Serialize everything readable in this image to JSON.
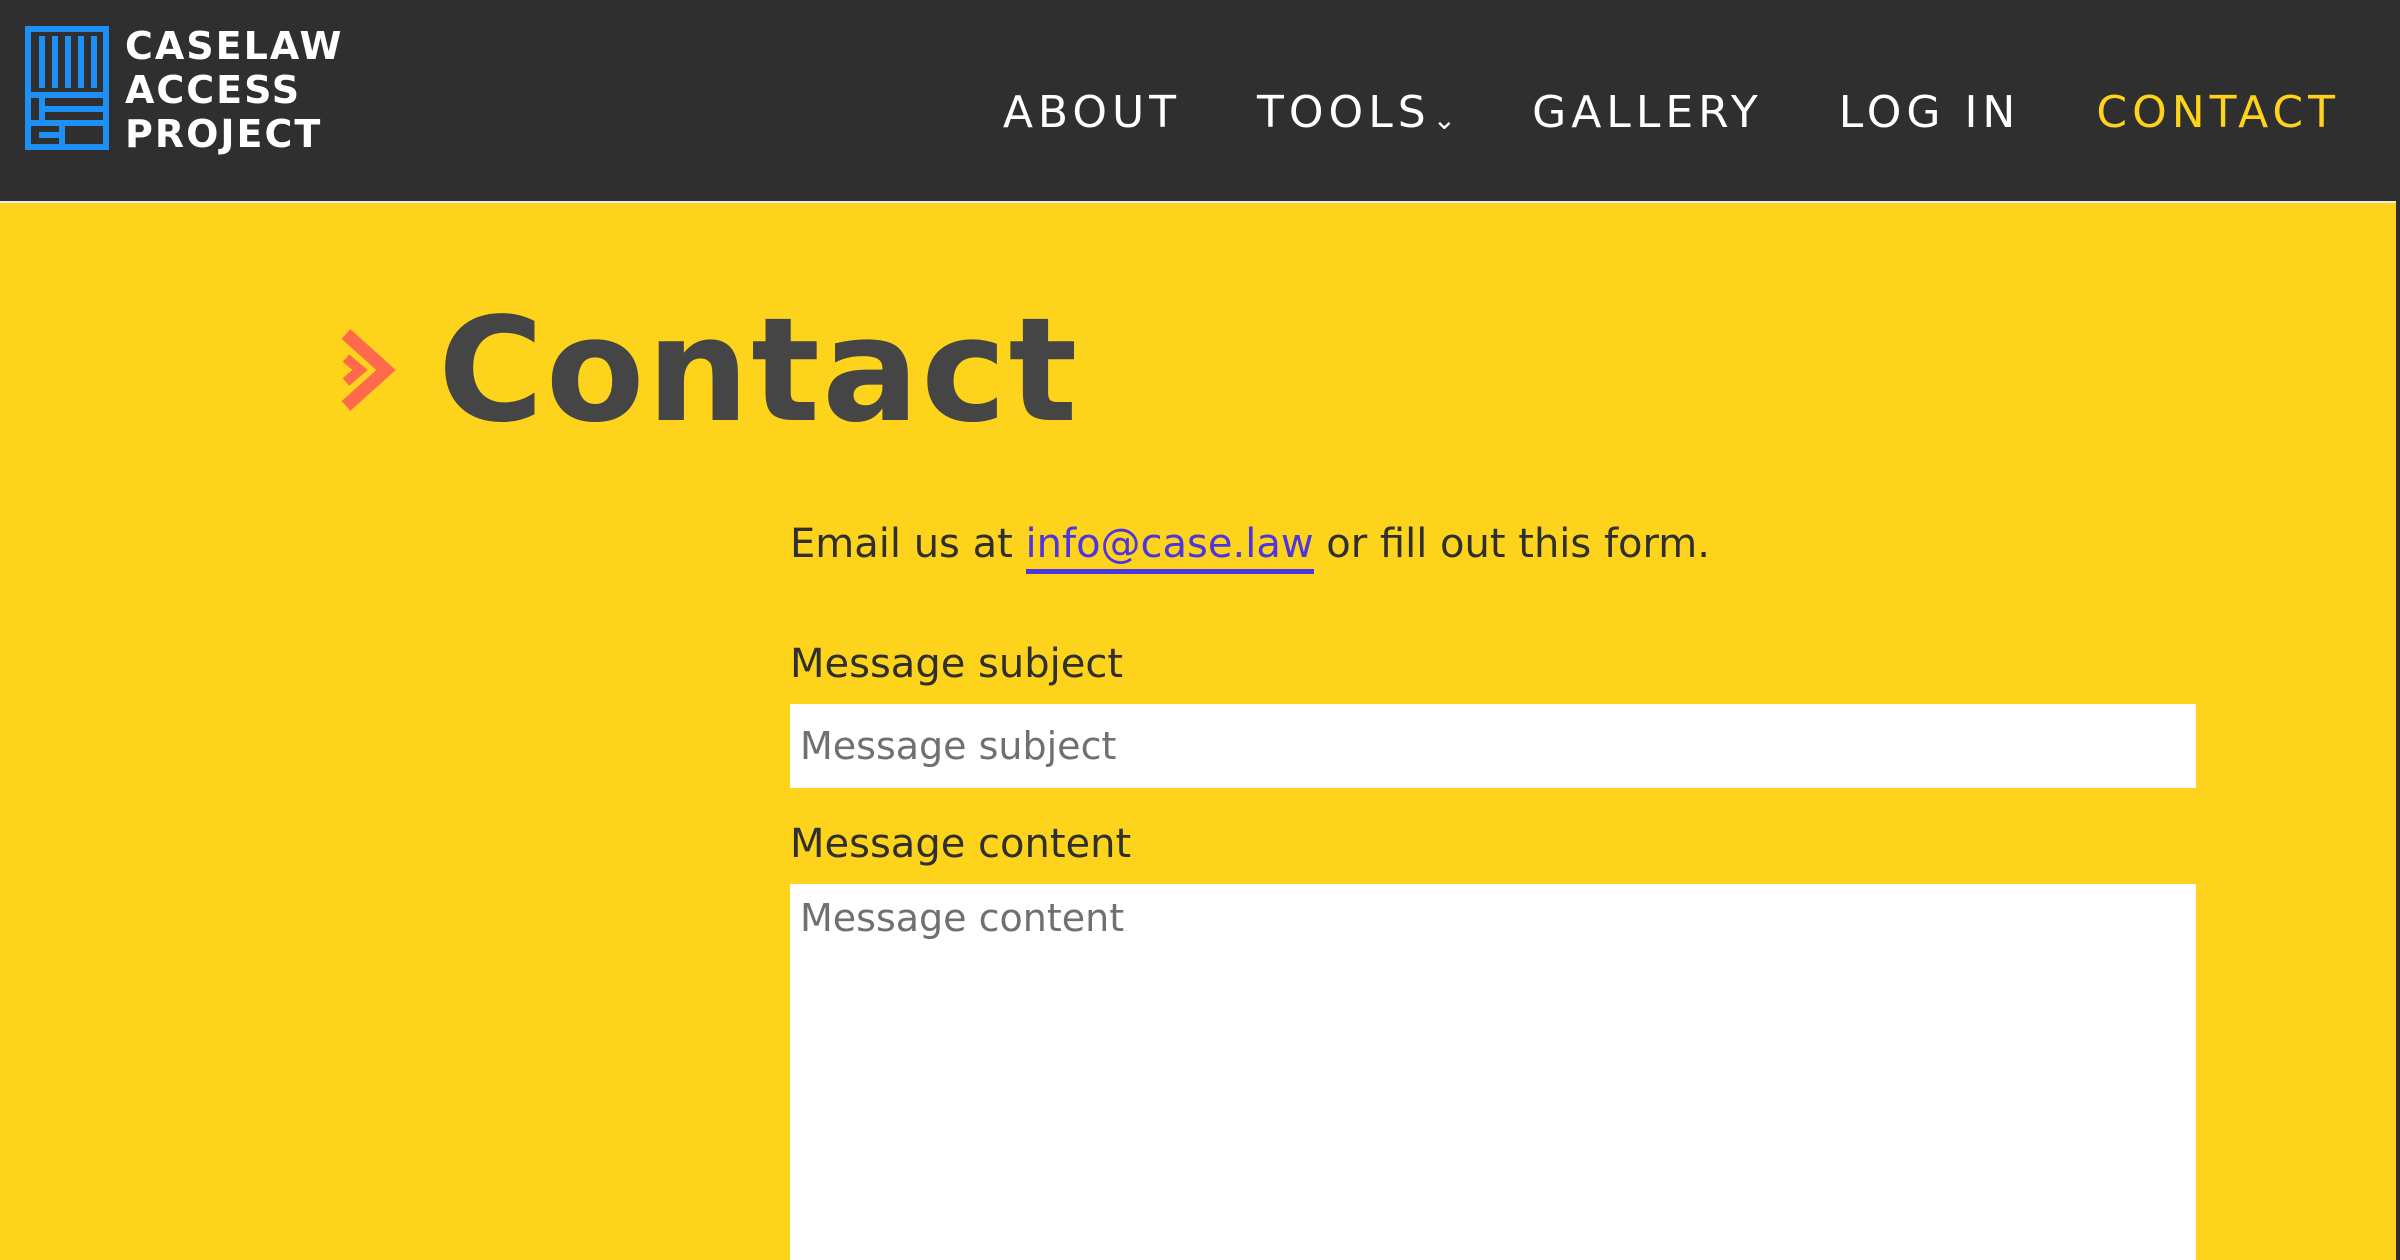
{
  "logo": {
    "lines": [
      "CASELAW",
      "ACCESS",
      "PROJECT"
    ],
    "icon": "case-law-grid-logo-icon",
    "color": "#1e90f5"
  },
  "nav": {
    "about": "ABOUT",
    "tools": "TOOLS",
    "gallery": "GALLERY",
    "login": "LOG IN",
    "contact": "CONTACT",
    "tools_caret_icon": "chevron-down-icon",
    "active_color": "#fdd31b"
  },
  "page": {
    "title": "Contact",
    "title_icon": "chevron-right-icon",
    "accent_color": "#ff6a4d",
    "background_color": "#fdd31b"
  },
  "intro": {
    "before": "Email us at ",
    "email": "info@case.law",
    "after": " or fill out this form."
  },
  "form": {
    "subject_label": "Message subject",
    "subject_placeholder": "Message subject",
    "content_label": "Message content",
    "content_placeholder": "Message content"
  }
}
